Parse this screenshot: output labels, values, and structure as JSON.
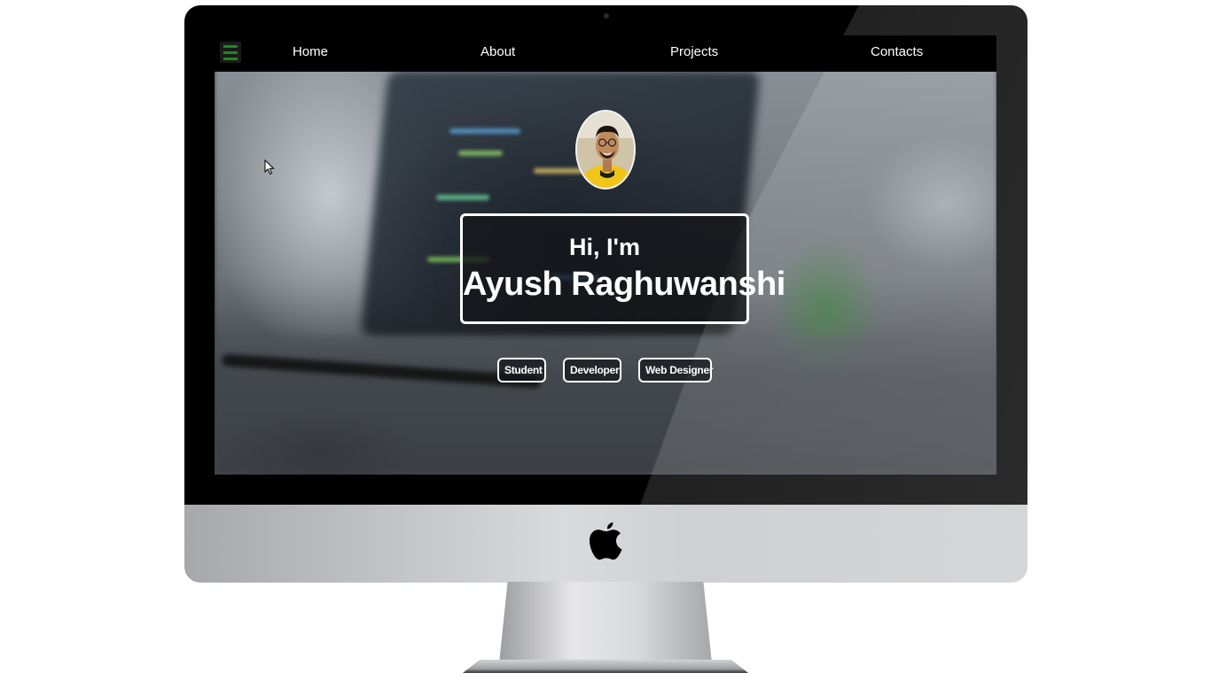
{
  "nav": {
    "menu_icon": "hamburger-icon",
    "links": [
      "Home",
      "About",
      "Projects",
      "Contacts"
    ]
  },
  "hero": {
    "avatar": "profile-photo",
    "greeting": "Hi, I'm",
    "name": "Ayush Raghuwanshi",
    "tags": [
      "Student",
      "Developer",
      "Web Designer"
    ]
  },
  "device": {
    "logo": "apple-logo-icon"
  },
  "colors": {
    "menu_icon_green": "#1c8a1c",
    "navbar_bg": "#000000",
    "text": "#ffffff"
  }
}
